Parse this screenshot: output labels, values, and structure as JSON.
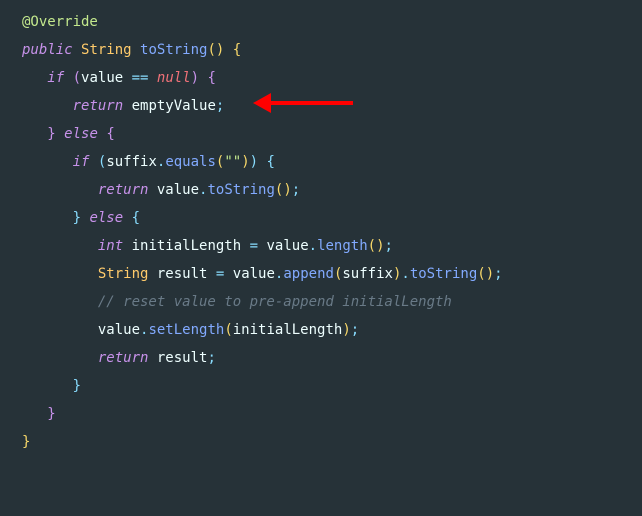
{
  "code": {
    "annotation": "@Override",
    "mod_public": "public",
    "type_string": "String",
    "method_toString": "toString",
    "kw_if": "if",
    "ident_value": "value",
    "op_eq": "==",
    "kw_null": "null",
    "kw_return": "return",
    "ident_emptyValue": "emptyValue",
    "kw_else": "else",
    "ident_suffix": "suffix",
    "method_equals": "equals",
    "str_empty": "\"\"",
    "type_int": "int",
    "ident_initialLength": "initialLength",
    "method_length": "length",
    "ident_result": "result",
    "method_append": "append",
    "method_setLength": "setLength",
    "comment_reset": "// reset value to pre-append initialLength"
  }
}
